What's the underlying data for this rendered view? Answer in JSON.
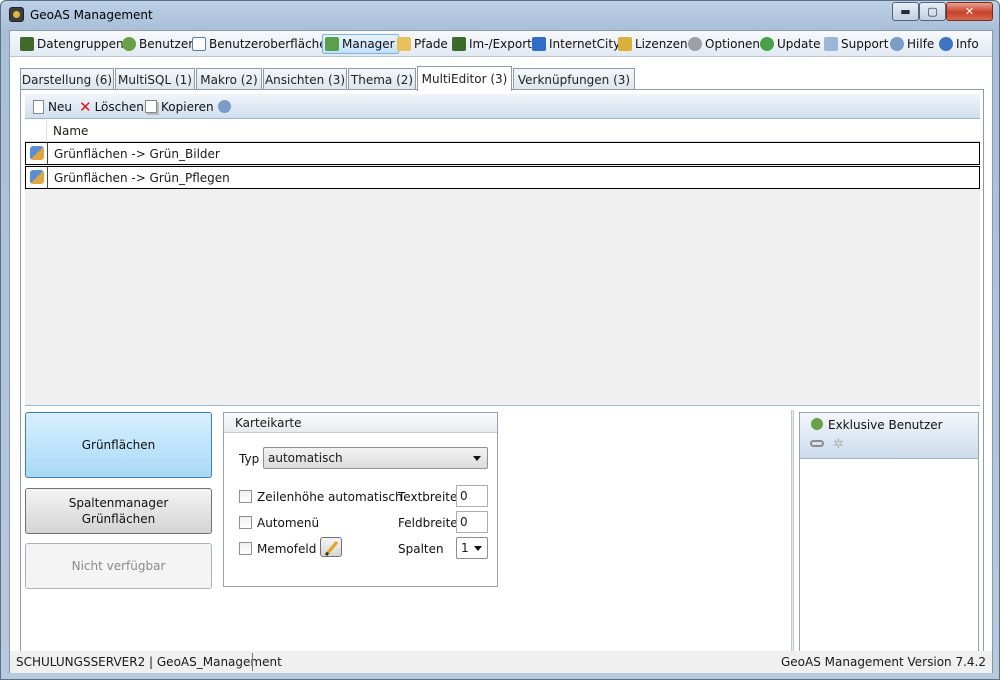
{
  "window": {
    "title": "GeoAS Management",
    "minimize": "▬",
    "maximize": "▢",
    "close": "✕"
  },
  "menu": [
    {
      "label": "Datengruppen",
      "icon": "database-icon",
      "color": "#3f6a2c"
    },
    {
      "label": "Benutzer",
      "icon": "user-icon",
      "color": "#6aa04a"
    },
    {
      "label": "Benutzeroberflächen",
      "icon": "window-icon",
      "color": "#5b7fa6"
    },
    {
      "label": "Manager",
      "icon": "manager-icon",
      "color": "#5aa04a",
      "active": true
    },
    {
      "label": "Pfade",
      "icon": "folder-icon",
      "color": "#e7c25a"
    },
    {
      "label": "Im-/Export",
      "icon": "layers-icon",
      "color": "#3b6a2a"
    },
    {
      "label": "InternetCity",
      "icon": "city-icon",
      "color": "#2f6dc7"
    },
    {
      "label": "Lizenzen",
      "icon": "key-icon",
      "color": "#d9b13a"
    },
    {
      "label": "Optionen",
      "icon": "gear-icon",
      "color": "#9aa0a6"
    },
    {
      "label": "Update",
      "icon": "refresh-icon",
      "color": "#4aa04a"
    },
    {
      "label": "Support",
      "icon": "mail-icon",
      "color": "#9db5d6"
    },
    {
      "label": "Hilfe",
      "icon": "help-icon",
      "color": "#7a9cc6"
    },
    {
      "label": "Info",
      "icon": "info-icon",
      "color": "#3f73c4"
    }
  ],
  "tabs": [
    {
      "label": "Darstellung (6)"
    },
    {
      "label": "MultiSQL (1)"
    },
    {
      "label": "Makro (2)"
    },
    {
      "label": "Ansichten (3)"
    },
    {
      "label": "Thema (2)"
    },
    {
      "label": "MultiEditor (3)",
      "active": true
    },
    {
      "label": "Verknüpfungen (3)"
    }
  ],
  "toolbar": {
    "new": "Neu",
    "delete": "Löschen",
    "copy": "Kopieren"
  },
  "grid": {
    "column": "Name",
    "rows": [
      "Grünflächen -> Grün_Bilder",
      "Grünflächen -> Grün_Pflegen"
    ]
  },
  "left_buttons": {
    "selected": "Grünflächen",
    "columns_manager": "Spaltenmanager\nGrünflächen",
    "unavailable": "Nicht verfügbar"
  },
  "karteikarte": {
    "title": "Karteikarte",
    "type_label": "Typ",
    "type_value": "automatisch",
    "row_height_auto": "Zeilenhöhe automatisch",
    "automenu": "Automenü",
    "memofield": "Memofeld",
    "text_width_label": "Textbreite",
    "text_width": "0",
    "field_width_label": "Feldbreite",
    "field_width": "0",
    "columns_label": "Spalten",
    "columns_value": "1"
  },
  "exclusive": {
    "title": "Exklusive Benutzer"
  },
  "status": {
    "left": "SCHULUNGSSERVER2 | GeoAS_Management",
    "right": "GeoAS Management Version 7.4.2"
  }
}
